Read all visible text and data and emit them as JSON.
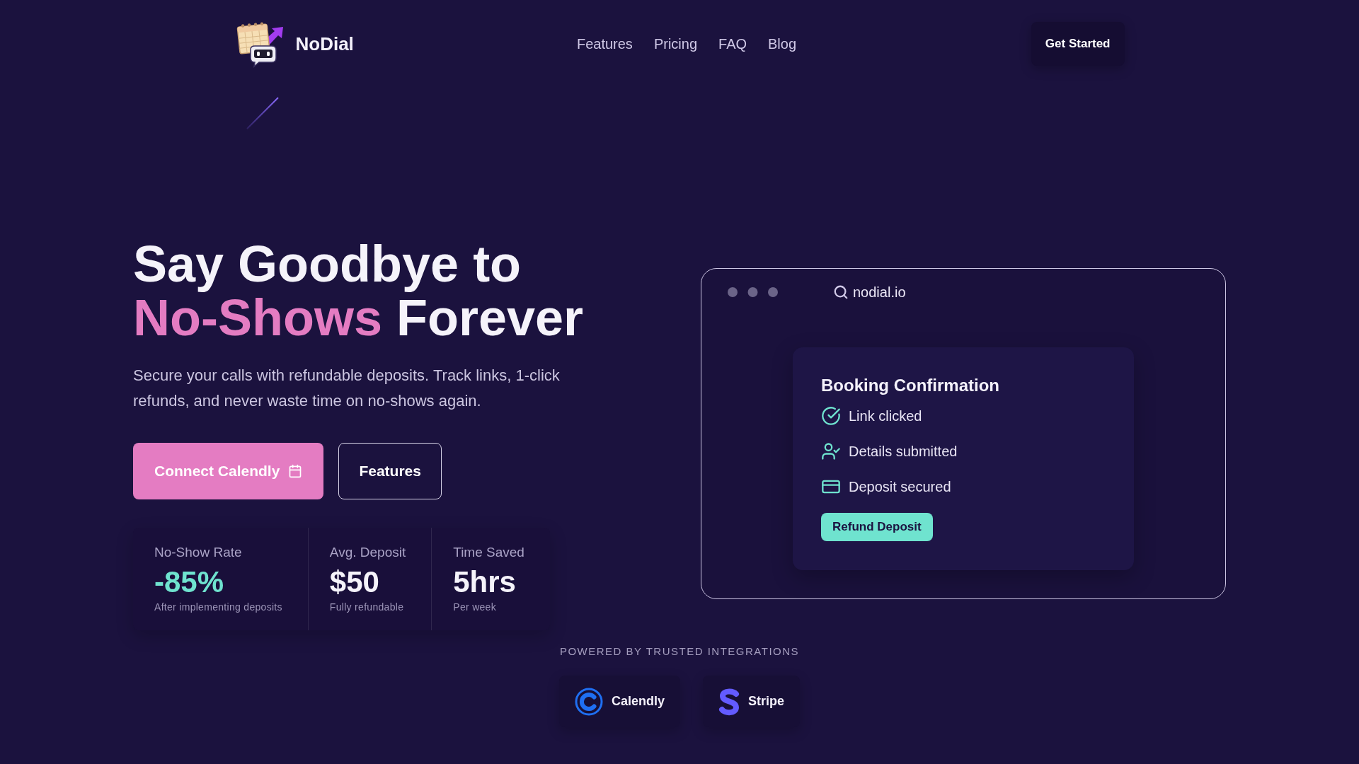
{
  "header": {
    "brand": "NoDial",
    "nav": [
      "Features",
      "Pricing",
      "FAQ",
      "Blog"
    ],
    "cta": "Get Started"
  },
  "hero": {
    "title_lines": [
      [
        {
          "text": "Say Goodbye to",
          "highlight": false
        }
      ],
      [
        {
          "text": "No-Shows",
          "highlight": true
        },
        {
          "text": "Forever",
          "highlight": false
        }
      ]
    ],
    "subtitle": "Secure your calls with refundable deposits. Track links, 1-click refunds, and never waste time on no-shows again.",
    "buttons": [
      {
        "label": "Connect Calendly",
        "kind": "primary"
      },
      {
        "label": "Features",
        "kind": "outline"
      }
    ],
    "stats": [
      {
        "label": "No-Show Rate",
        "value": "-85%",
        "note": "After implementing deposits",
        "accent": true
      },
      {
        "label": "Avg. Deposit",
        "value": "$50",
        "note": "Fully refundable",
        "accent": false
      },
      {
        "label": "Time Saved",
        "value": "5hrs",
        "note": "Per week",
        "accent": false
      }
    ]
  },
  "preview": {
    "url": "nodial.io",
    "card": {
      "title": "Booking Confirmation",
      "steps": [
        {
          "label": "Link clicked",
          "kind": "check"
        },
        {
          "label": "Details submitted",
          "kind": "user"
        },
        {
          "label": "Deposit secured",
          "kind": "card"
        }
      ],
      "button": "Refund Deposit"
    }
  },
  "integrations": {
    "heading": "POWERED BY TRUSTED INTEGRATIONS",
    "items": [
      {
        "name": "Calendly",
        "kind": "calendly"
      },
      {
        "name": "Stripe",
        "kind": "stripe"
      }
    ]
  }
}
